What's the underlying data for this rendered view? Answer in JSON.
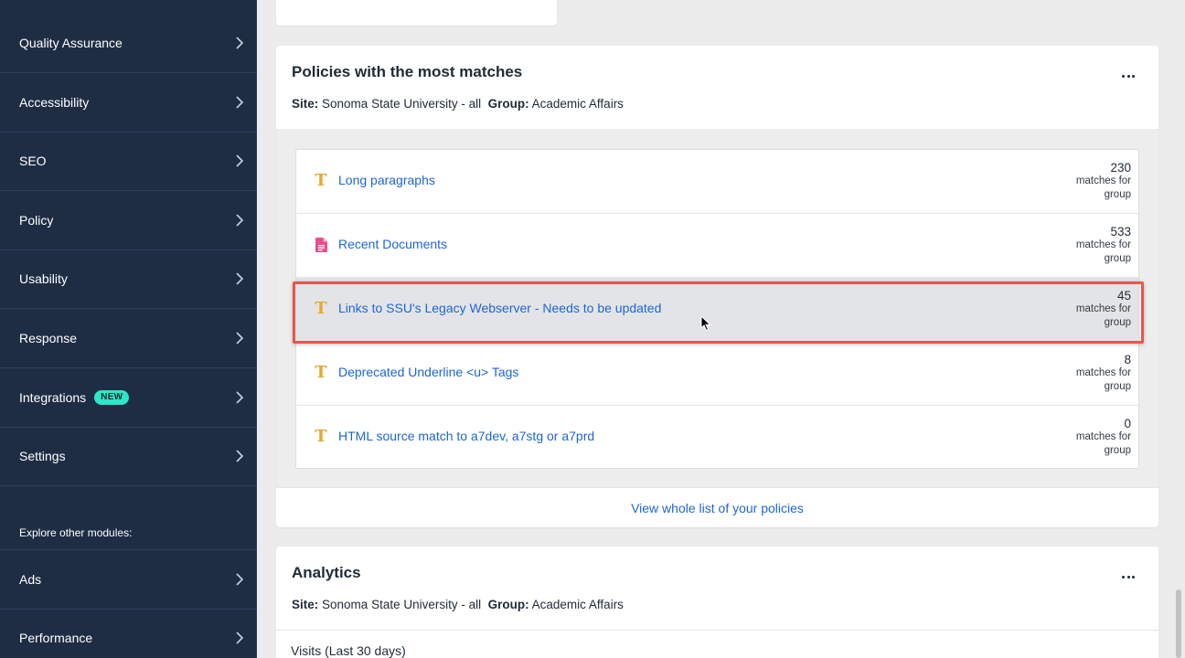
{
  "sidebar": {
    "items": [
      {
        "label": "Quality Assurance"
      },
      {
        "label": "Accessibility"
      },
      {
        "label": "SEO"
      },
      {
        "label": "Policy"
      },
      {
        "label": "Usability"
      },
      {
        "label": "Response"
      },
      {
        "label": "Integrations",
        "badge": "NEW"
      },
      {
        "label": "Settings"
      }
    ],
    "explore_label": "Explore other modules:",
    "modules": [
      {
        "label": "Ads"
      },
      {
        "label": "Performance"
      }
    ]
  },
  "policies_card": {
    "title": "Policies with the most matches",
    "site_label": "Site:",
    "site_value": "Sonoma State University - all",
    "group_label": "Group:",
    "group_value": "Academic Affairs",
    "rows": [
      {
        "icon": "text-t-icon",
        "name": "Long paragraphs",
        "count": "230",
        "count_label": "matches for group"
      },
      {
        "icon": "document-icon",
        "name": "Recent Documents",
        "count": "533",
        "count_label": "matches for group"
      },
      {
        "icon": "text-t-icon",
        "name": "Links to SSU's Legacy Webserver - Needs to be updated",
        "count": "45",
        "count_label": "matches for group"
      },
      {
        "icon": "text-t-icon",
        "name": "Deprecated Underline <u> Tags",
        "count": "8",
        "count_label": "matches for group"
      },
      {
        "icon": "text-t-icon",
        "name": "HTML source match to a7dev, a7stg or a7prd",
        "count": "0",
        "count_label": "matches for group"
      }
    ],
    "view_all": "View whole list of your policies"
  },
  "analytics_card": {
    "title": "Analytics",
    "site_label": "Site:",
    "site_value": "Sonoma State University - all",
    "group_label": "Group:",
    "group_value": "Academic Affairs",
    "visits_label": "Visits (Last 30 days)"
  },
  "colors": {
    "sidebar_bg": "#1f2d44",
    "link": "#1c66d6",
    "t_icon": "#e8a82b",
    "doc_icon": "#ec4e8f",
    "badge_new": "#2ee6c8",
    "highlight_border": "#e8574a"
  }
}
